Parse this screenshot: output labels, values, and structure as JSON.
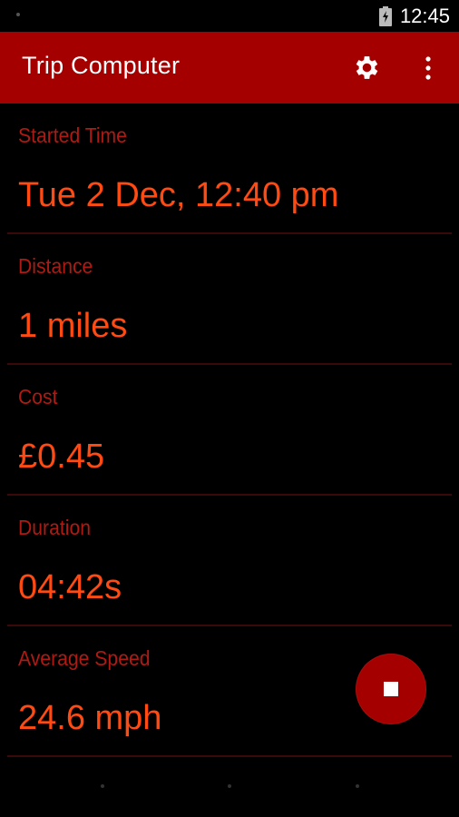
{
  "status_bar": {
    "time": "12:45",
    "icons": [
      "notification-dot",
      "battery-charging-icon"
    ]
  },
  "app_bar": {
    "title": "Trip Computer",
    "actions": [
      "gear-icon",
      "overflow-menu-icon"
    ]
  },
  "rows": [
    {
      "label": "Started Time",
      "value": "Tue 2 Dec, 12:40 pm"
    },
    {
      "label": "Distance",
      "value": "1 miles"
    },
    {
      "label": "Cost",
      "value": "£0.45"
    },
    {
      "label": "Duration",
      "value": "04:42s"
    },
    {
      "label": "Average Speed",
      "value": "24.6 mph"
    }
  ],
  "fab": {
    "icon": "stop-icon"
  },
  "colors": {
    "app_bar": "#a50000",
    "label": "#b01a12",
    "value": "#ff4a12",
    "background": "#000000"
  }
}
